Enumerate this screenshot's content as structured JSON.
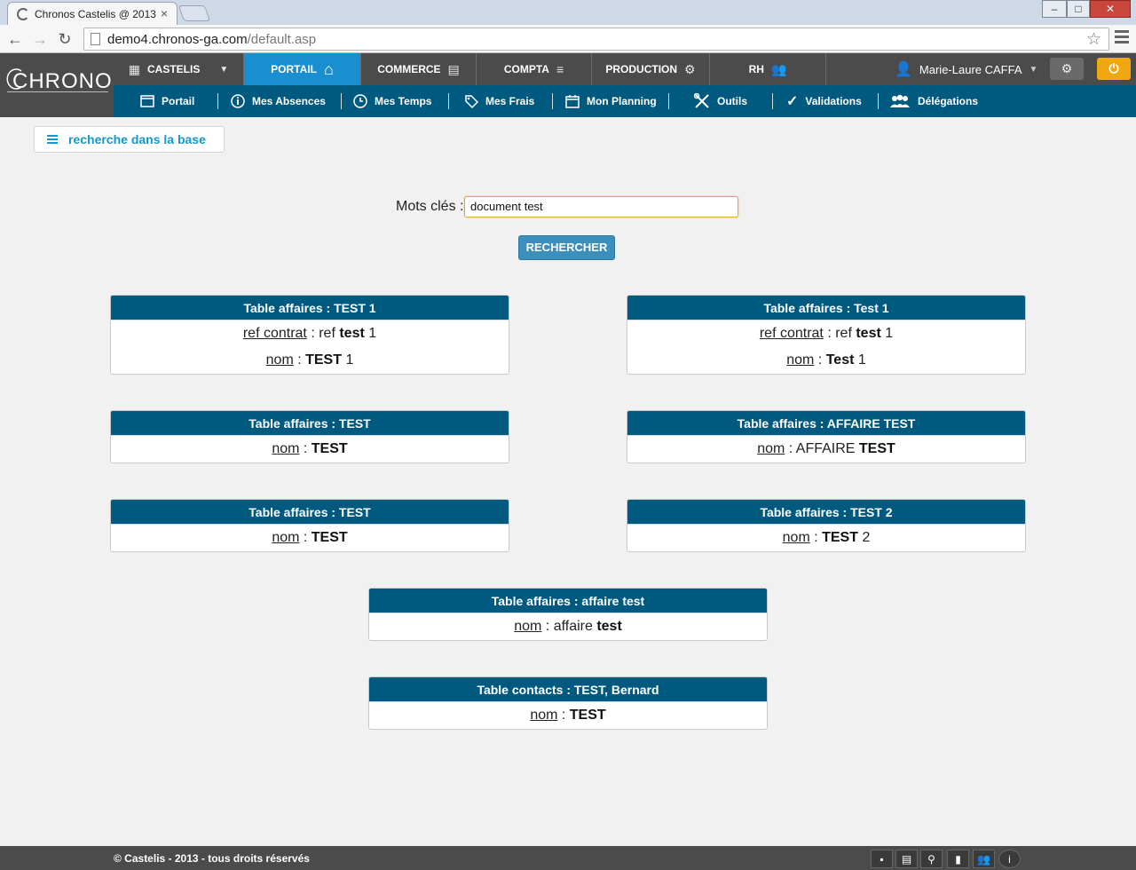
{
  "browser": {
    "tab_title": "Chronos Castelis @ 2013",
    "url_host": "demo4.chronos-ga.com",
    "url_path": "/default.asp"
  },
  "app": {
    "logo": "CHRONOS",
    "topnav": [
      {
        "label": "CASTELIS",
        "icon": "building-icon"
      },
      {
        "label": "PORTAIL",
        "icon": "home-icon"
      },
      {
        "label": "COMMERCE",
        "icon": "contact-book-icon"
      },
      {
        "label": "COMPTA",
        "icon": "coins-icon"
      },
      {
        "label": "PRODUCTION",
        "icon": "gears-icon"
      },
      {
        "label": "RH",
        "icon": "people-icon"
      }
    ],
    "user_name": "Marie-Laure CAFFA",
    "subnav": [
      {
        "label": "Portail",
        "icon": "window-icon"
      },
      {
        "label": "Mes Absences",
        "icon": "info-icon"
      },
      {
        "label": "Mes Temps",
        "icon": "clock-icon"
      },
      {
        "label": "Mes Frais",
        "icon": "tag-icon"
      },
      {
        "label": "Mon Planning",
        "icon": "calendar-icon"
      },
      {
        "label": "Outils",
        "icon": "tools-icon"
      },
      {
        "label": "Validations",
        "icon": "checkmark-icon"
      },
      {
        "label": "Délégations",
        "icon": "group-icon"
      }
    ]
  },
  "search": {
    "tab_label": "recherche dans la base",
    "keywords_label": "Mots clés :",
    "keywords_value": "document test",
    "button_label": "RECHERCHER"
  },
  "results": [
    {
      "title": "Table affaires : TEST 1",
      "rows": [
        {
          "field": "ref contrat",
          "sep": " : ",
          "pre": "ref ",
          "bold": "test",
          "post": " 1"
        },
        {
          "field": "nom",
          "sep": " : ",
          "pre": "",
          "bold": "TEST",
          "post": " 1"
        }
      ]
    },
    {
      "title": "Table affaires : Test 1",
      "rows": [
        {
          "field": "ref contrat",
          "sep": " : ",
          "pre": "ref ",
          "bold": "test",
          "post": " 1"
        },
        {
          "field": "nom",
          "sep": " : ",
          "pre": "",
          "bold": "Test",
          "post": " 1"
        }
      ]
    },
    {
      "title": "Table affaires : TEST",
      "rows": [
        {
          "field": "nom",
          "sep": " : ",
          "pre": "",
          "bold": "TEST",
          "post": ""
        }
      ]
    },
    {
      "title": "Table affaires : AFFAIRE TEST",
      "rows": [
        {
          "field": "nom",
          "sep": " : ",
          "pre": "AFFAIRE ",
          "bold": "TEST",
          "post": ""
        }
      ]
    },
    {
      "title": "Table affaires : TEST",
      "rows": [
        {
          "field": "nom",
          "sep": " : ",
          "pre": "",
          "bold": "TEST",
          "post": ""
        }
      ]
    },
    {
      "title": "Table affaires : TEST 2",
      "rows": [
        {
          "field": "nom",
          "sep": " : ",
          "pre": "",
          "bold": "TEST",
          "post": " 2"
        }
      ]
    },
    {
      "title": "Table affaires : affaire test",
      "rows": [
        {
          "field": "nom",
          "sep": " : ",
          "pre": "affaire ",
          "bold": "test",
          "post": ""
        }
      ]
    },
    {
      "title": "Table contacts : TEST, Bernard",
      "rows": [
        {
          "field": "nom",
          "sep": " : ",
          "pre": "",
          "bold": "TEST",
          "post": ""
        }
      ]
    }
  ],
  "footer": {
    "copyright": "© Castelis - 2013 - tous droits réservés",
    "icons": [
      "save-icon",
      "card-icon",
      "search-icon",
      "book-icon",
      "users-icon",
      "info-icon"
    ]
  },
  "colors": {
    "header_bg": "#4b4b4b",
    "nav_blue": "#005a80",
    "active_blue": "#1a8fd0",
    "power_orange": "#f0a810"
  }
}
